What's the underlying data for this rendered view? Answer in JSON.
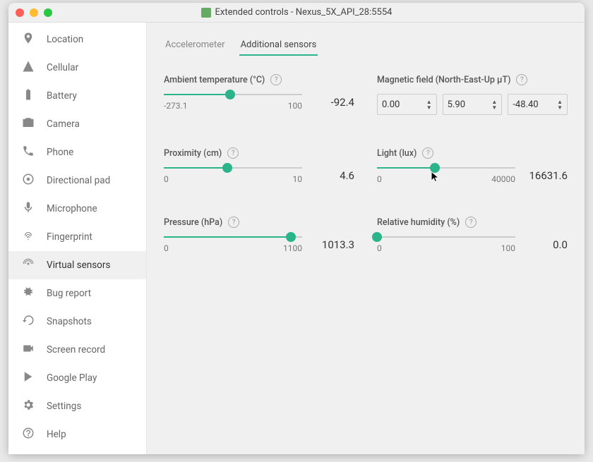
{
  "window": {
    "title": "Extended controls - Nexus_5X_API_28:5554"
  },
  "sidebar": {
    "items": [
      {
        "label": "Location",
        "icon": "location"
      },
      {
        "label": "Cellular",
        "icon": "cellular"
      },
      {
        "label": "Battery",
        "icon": "battery"
      },
      {
        "label": "Camera",
        "icon": "camera"
      },
      {
        "label": "Phone",
        "icon": "phone"
      },
      {
        "label": "Directional pad",
        "icon": "dpad"
      },
      {
        "label": "Microphone",
        "icon": "mic"
      },
      {
        "label": "Fingerprint",
        "icon": "fingerprint"
      },
      {
        "label": "Virtual sensors",
        "icon": "sensors",
        "active": true
      },
      {
        "label": "Bug report",
        "icon": "bug"
      },
      {
        "label": "Snapshots",
        "icon": "snapshot"
      },
      {
        "label": "Screen record",
        "icon": "record"
      },
      {
        "label": "Google Play",
        "icon": "play"
      },
      {
        "label": "Settings",
        "icon": "settings"
      },
      {
        "label": "Help",
        "icon": "help"
      }
    ]
  },
  "tabs": [
    {
      "label": "Accelerometer",
      "active": false
    },
    {
      "label": "Additional sensors",
      "active": true
    }
  ],
  "sensors": {
    "ambient": {
      "label": "Ambient temperature (°C)",
      "min": "-273.1",
      "max": "100",
      "value": "-92.4",
      "fill_pct": 48
    },
    "magnetic": {
      "label": "Magnetic field (North-East-Up μT)",
      "x": "0.00",
      "y": "5.90",
      "z": "-48.40"
    },
    "proximity": {
      "label": "Proximity (cm)",
      "min": "0",
      "max": "10",
      "value": "4.6",
      "fill_pct": 46
    },
    "light": {
      "label": "Light (lux)",
      "min": "0",
      "max": "40000",
      "value": "16631.6",
      "fill_pct": 41.6
    },
    "pressure": {
      "label": "Pressure (hPa)",
      "min": "0",
      "max": "1100",
      "value": "1013.3",
      "fill_pct": 92
    },
    "humidity": {
      "label": "Relative humidity (%)",
      "min": "0",
      "max": "100",
      "value": "0.0",
      "fill_pct": 0
    }
  }
}
